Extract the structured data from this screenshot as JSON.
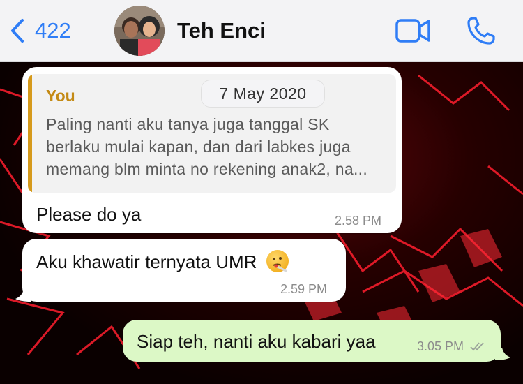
{
  "nav": {
    "back_count": "422",
    "contact_name": "Teh Enci"
  },
  "date_separator": "7 May 2020",
  "messages": [
    {
      "direction": "incoming",
      "quote_author": "You",
      "quote_lines": [
        "Paling nanti aku tanya juga tanggal SK",
        "berlaku mulai kapan, dan dari labkes juga",
        "memang blm minta no rekening anak2, na..."
      ],
      "text": "Please do ya",
      "time": "2.58 PM"
    },
    {
      "direction": "incoming",
      "text": "Aku khawatir ternyata UMR",
      "emoji": "face-with-thermometer",
      "time": "2.59 PM"
    },
    {
      "direction": "outgoing",
      "text": "Siap teh, nanti aku kabari yaa",
      "time": "3.05 PM",
      "status": "read"
    }
  ],
  "colors": {
    "accent": "#2f7df6",
    "quote_author": "#c48a14",
    "outgoing_bubble": "#dcf8c6",
    "incoming_bubble": "#ffffff"
  }
}
